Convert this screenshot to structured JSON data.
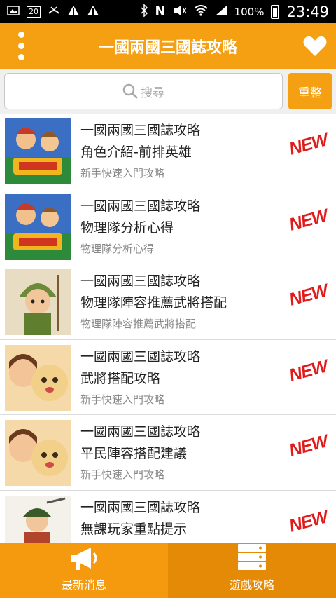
{
  "status_bar": {
    "left_icons": [
      "image-icon",
      "calendar-icon",
      "missed-call-icon",
      "warning-icon",
      "warning-icon"
    ],
    "calendar_day": "20",
    "right_icons": [
      "bluetooth-icon",
      "nfc-icon",
      "mute-icon",
      "wifi-icon",
      "signal-icon"
    ],
    "battery": "100%",
    "time": "23:49"
  },
  "app_bar": {
    "title": "一國兩國三國誌攻略"
  },
  "search": {
    "placeholder": "搜尋",
    "reset_label": "重整"
  },
  "list": {
    "items": [
      {
        "title": "一國兩國三國誌攻略",
        "subtitle": "角色介紹-前排英雄",
        "category": "新手快速入門攻略",
        "badge": "NEW"
      },
      {
        "title": "一國兩國三國誌攻略",
        "subtitle": "物理隊分析心得",
        "category": "物理隊分析心得",
        "badge": "NEW"
      },
      {
        "title": "一國兩國三國誌攻略",
        "subtitle": "物理隊陣容推薦武將搭配",
        "category": "物理隊陣容推薦武將搭配",
        "badge": "NEW"
      },
      {
        "title": "一國兩國三國誌攻略",
        "subtitle": "武將搭配攻略",
        "category": "新手快速入門攻略",
        "badge": "NEW"
      },
      {
        "title": "一國兩國三國誌攻略",
        "subtitle": "平民陣容搭配建議",
        "category": "新手快速入門攻略",
        "badge": "NEW"
      },
      {
        "title": "一國兩國三國誌攻略",
        "subtitle": "無課玩家重點提示",
        "category": "",
        "badge": "NEW"
      }
    ]
  },
  "bottom_nav": {
    "news_label": "最新消息",
    "guide_label": "遊戲攻略"
  },
  "colors": {
    "accent": "#f5a012",
    "badge": "#e01b1b"
  }
}
